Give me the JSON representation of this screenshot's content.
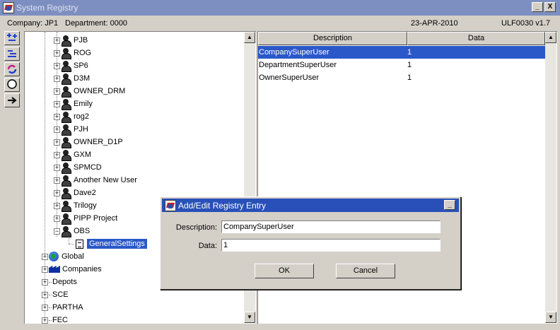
{
  "window": {
    "title": "System Registry",
    "minimize_glyph": "_",
    "close_glyph": "X"
  },
  "info": {
    "company": "Company:  JP1",
    "department": "Department:  0000",
    "date": "23-APR-2010",
    "code": "ULF0030  v1.7"
  },
  "toolbar": {
    "icons": [
      "expand-all-icon",
      "collapse-all-icon",
      "refresh-icon",
      "search-icon",
      "go-arrow-icon"
    ]
  },
  "tree": {
    "users": [
      "PJB",
      "ROG",
      "SP6",
      "D3M",
      "OWNER_DRM",
      "Emily",
      "rog2",
      "PJH",
      "OWNER_D1P",
      "GXM",
      "SPMCD",
      "Another New User",
      "Dave2",
      "Trilogy",
      "PIPP Project",
      "OBS"
    ],
    "selected_child": "GeneralSettings",
    "global": "Global",
    "companies": "Companies",
    "others": [
      "Depots",
      "SCE",
      "PARTHA",
      "FEC"
    ],
    "plus": "+",
    "minus": "−"
  },
  "grid": {
    "columns": [
      "Description",
      "Data"
    ],
    "rows": [
      {
        "description": "CompanySuperUser",
        "data": "1"
      },
      {
        "description": "DepartmentSuperUser",
        "data": "1"
      },
      {
        "description": "OwnerSuperUser",
        "data": "1"
      }
    ]
  },
  "dialog": {
    "title": "Add/Edit Registry Entry",
    "description_label": "Description:",
    "description_value": "CompanySuperUser",
    "data_label": "Data:",
    "data_value": "1",
    "ok_label": "OK",
    "cancel_label": "Cancel",
    "minimize_glyph": "_"
  },
  "colors": {
    "titlebar": "#7d8ec0",
    "dialog_titlebar": "#2850b8",
    "selection": "#2a58c8",
    "face": "#d4d0c8"
  }
}
